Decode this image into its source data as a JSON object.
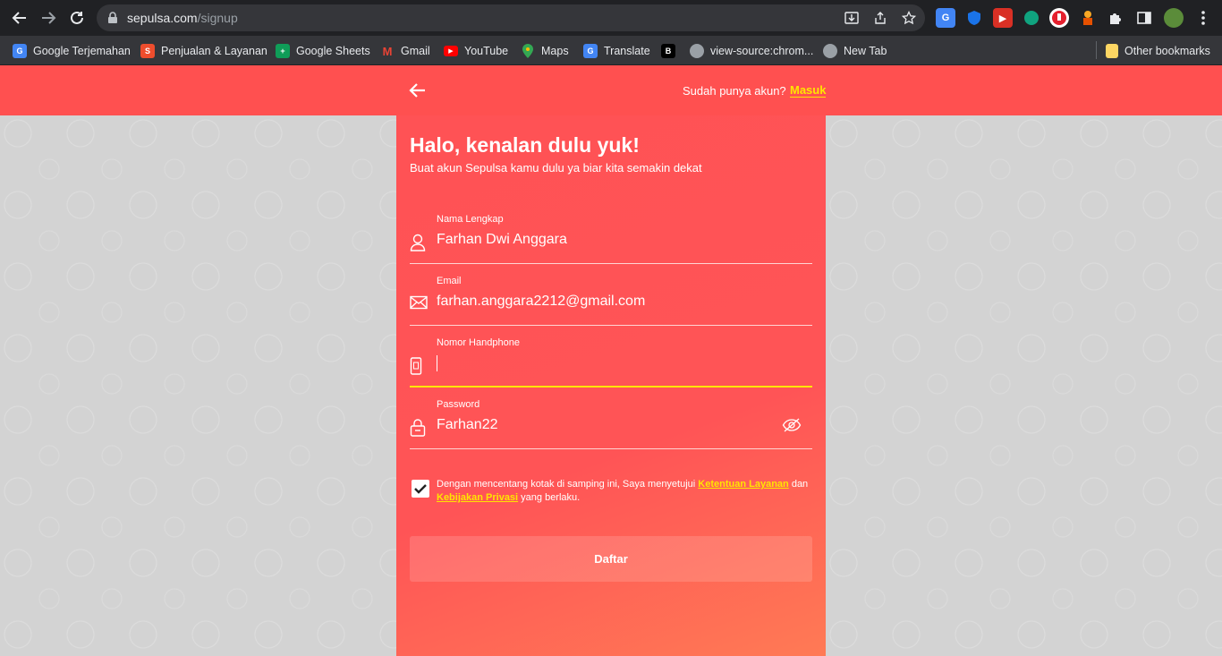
{
  "browser": {
    "url_host": "sepulsa.com",
    "url_path": "/signup",
    "bookmarks": [
      {
        "label": "Google Terjemahan",
        "icon": "google-translate-icon",
        "color": "#4285f4"
      },
      {
        "label": "Penjualan & Layanan",
        "icon": "shopee-icon",
        "color": "#ee4d2d"
      },
      {
        "label": "Google Sheets",
        "icon": "sheets-icon",
        "color": "#0f9d58"
      },
      {
        "label": "Gmail",
        "icon": "gmail-icon",
        "color": "#ea4335"
      },
      {
        "label": "YouTube",
        "icon": "youtube-icon",
        "color": "#ff0000"
      },
      {
        "label": "Maps",
        "icon": "maps-icon",
        "color": "#34a853"
      },
      {
        "label": "Translate",
        "icon": "translate-icon",
        "color": "#4285f4"
      },
      {
        "label": "",
        "icon": "b-icon",
        "color": "#000000"
      },
      {
        "label": "view-source:chrom...",
        "icon": "globe-icon",
        "color": "#9aa0a6"
      },
      {
        "label": "New Tab",
        "icon": "globe-icon",
        "color": "#9aa0a6"
      }
    ],
    "other_bookmarks": "Other bookmarks"
  },
  "header": {
    "have_account": "Sudah punya akun?",
    "login_link": "Masuk"
  },
  "form": {
    "title": "Halo, kenalan dulu yuk!",
    "subtitle": "Buat akun Sepulsa kamu dulu ya biar kita semakin dekat",
    "fields": {
      "name": {
        "label": "Nama Lengkap",
        "value": "Farhan Dwi Anggara"
      },
      "email": {
        "label": "Email",
        "value": "farhan.anggara2212@gmail.com"
      },
      "phone": {
        "label": "Nomor Handphone",
        "value": ""
      },
      "password": {
        "label": "Password",
        "value": "Farhan22"
      }
    },
    "terms": {
      "prefix": "Dengan mencentang kotak di samping ini, Saya menyetujui ",
      "link1": "Ketentuan Layanan",
      "middle": " dan ",
      "link2": "Kebijakan Privasi",
      "suffix": " yang berlaku.",
      "checked": true
    },
    "submit_label": "Daftar"
  },
  "colors": {
    "brand": "#ff5050",
    "accent": "#ffe500"
  }
}
